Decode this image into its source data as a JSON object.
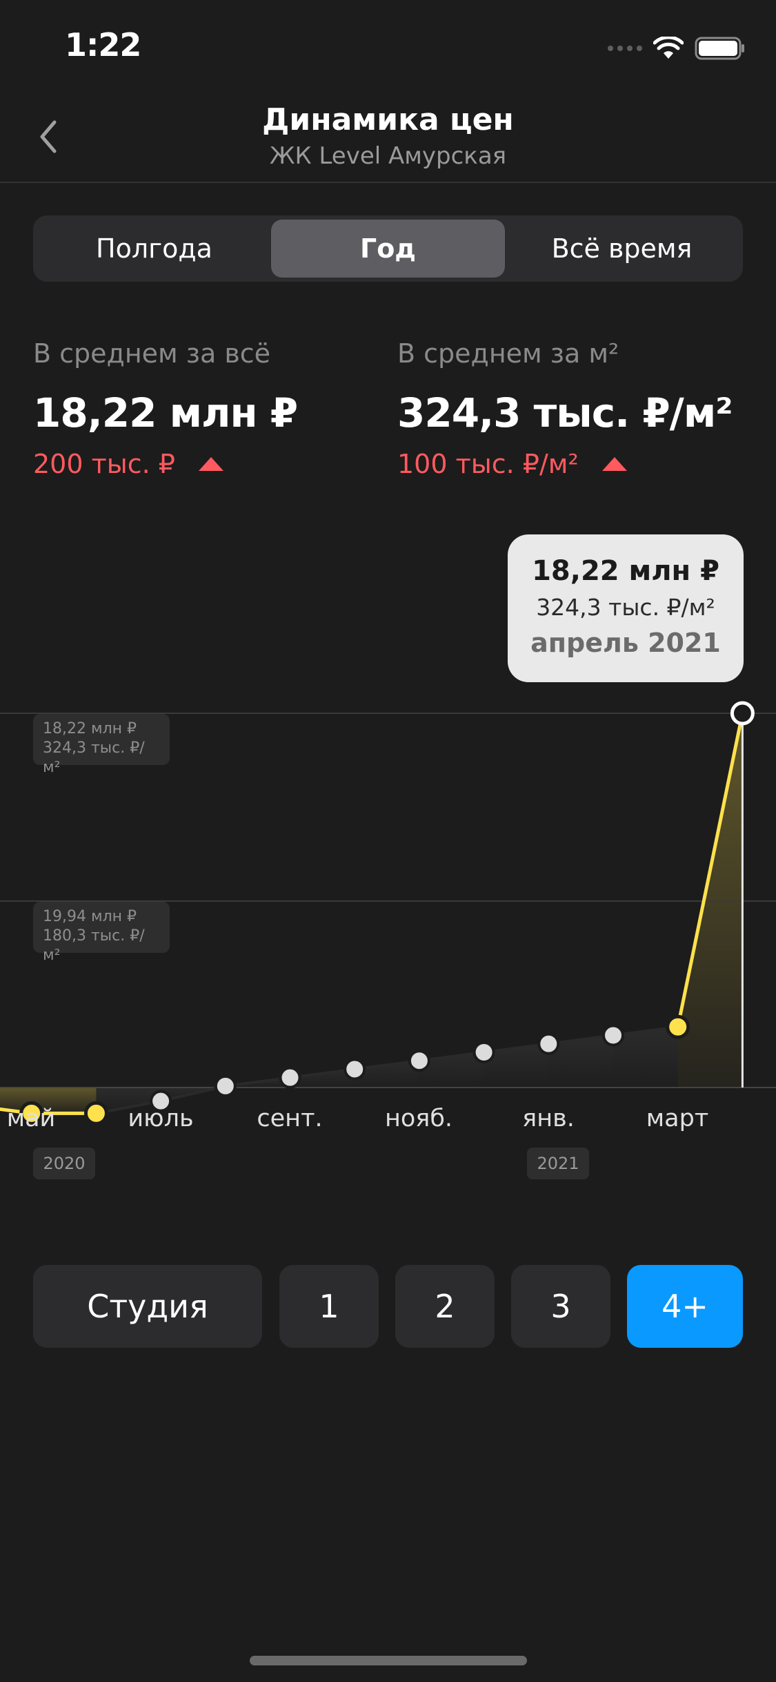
{
  "status_bar": {
    "time": "1:22"
  },
  "nav": {
    "title": "Динамика цен",
    "subtitle": "ЖК Level Амурская"
  },
  "period_tabs": [
    {
      "label": "Полгода",
      "active": false
    },
    {
      "label": "Год",
      "active": true
    },
    {
      "label": "Всё время",
      "active": false
    }
  ],
  "stats": {
    "total": {
      "label": "В среднем за всё",
      "value": "18,22 млн ₽",
      "change": "200 тыс. ₽",
      "trend": "up"
    },
    "per_sqm": {
      "label": "В среднем за м²",
      "value": "324,3 тыс. ₽/м²",
      "change": "100 тыс. ₽/м²",
      "trend": "up"
    }
  },
  "tooltip": {
    "price": "18,22 млн ₽",
    "per_sqm": "324,3 тыс. ₽/м²",
    "date": "апрель 2021"
  },
  "range_labels": {
    "max": {
      "price": "18,22 млн ₽",
      "per_sqm": "324,3 тыс. ₽/м²"
    },
    "min": {
      "price": "19,94 млн ₽",
      "per_sqm": "180,3 тыс. ₽/м²"
    }
  },
  "x_axis": {
    "labels": [
      "май",
      "июль",
      "сент.",
      "нояб.",
      "янв.",
      "март"
    ],
    "years": [
      "2020",
      "2021"
    ]
  },
  "room_buttons": [
    {
      "label": "Студия",
      "active": false
    },
    {
      "label": "1",
      "active": false
    },
    {
      "label": "2",
      "active": false
    },
    {
      "label": "3",
      "active": false
    },
    {
      "label": "4+",
      "active": true
    }
  ],
  "colors": {
    "accent": "#0a99ff",
    "negative": "#ff5a5f",
    "line": "#ffe14d",
    "background": "#1c1c1c"
  },
  "chart_data": {
    "type": "line",
    "title": "",
    "xlabel": "",
    "ylabel": "",
    "x": [
      "2020-04",
      "2020-05",
      "2020-06",
      "2020-07",
      "2020-08",
      "2020-09",
      "2020-10",
      "2020-11",
      "2020-12",
      "2021-01",
      "2021-02",
      "2021-03",
      "2021-04"
    ],
    "series": [
      {
        "values": [
          14.05,
          13.96,
          13.96,
          14.09,
          14.25,
          14.34,
          14.43,
          14.52,
          14.61,
          14.7,
          14.79,
          14.88,
          18.22
        ],
        "highlighted": [
          true,
          true,
          true,
          false,
          false,
          false,
          false,
          false,
          false,
          false,
          false,
          true,
          true
        ]
      }
    ],
    "reference_lines": [
      18.22,
      16.22
    ],
    "selected_point": "2021-04"
  }
}
